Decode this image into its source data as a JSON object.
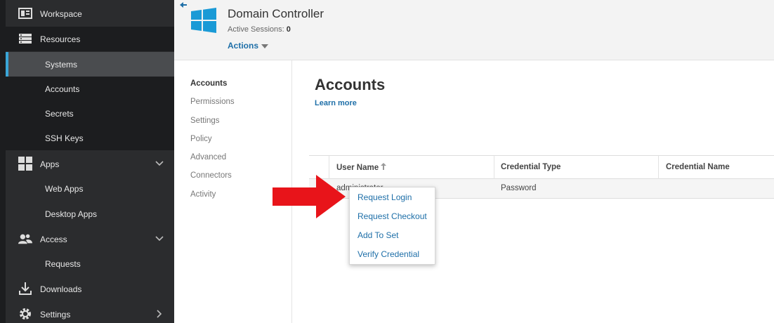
{
  "sidebar": {
    "items": [
      {
        "label": "Workspace"
      },
      {
        "label": "Resources"
      },
      {
        "label": "Systems"
      },
      {
        "label": "Accounts"
      },
      {
        "label": "Secrets"
      },
      {
        "label": "SSH Keys"
      },
      {
        "label": "Apps"
      },
      {
        "label": "Web Apps"
      },
      {
        "label": "Desktop Apps"
      },
      {
        "label": "Access"
      },
      {
        "label": "Requests"
      },
      {
        "label": "Downloads"
      },
      {
        "label": "Settings"
      }
    ]
  },
  "header": {
    "title": "Domain Controller",
    "sessions_label": "Active Sessions:",
    "sessions_count": "0",
    "actions_label": "Actions"
  },
  "subnav": {
    "items": [
      "Accounts",
      "Permissions",
      "Settings",
      "Policy",
      "Advanced",
      "Connectors",
      "Activity"
    ]
  },
  "main": {
    "title": "Accounts",
    "learn_more": "Learn more",
    "table": {
      "headers": [
        "User Name",
        "Credential Type",
        "Credential Name"
      ],
      "rows": [
        {
          "user": "administrator",
          "type": "Password",
          "name": ""
        }
      ]
    }
  },
  "context_menu": {
    "items": [
      "Request Login",
      "Request Checkout",
      "Add To Set",
      "Verify Credential"
    ]
  },
  "colors": {
    "accent": "#3aa6d8",
    "link": "#1e6fa8",
    "sidebar_bg": "#2b2c2e",
    "pointer_arrow": "#e8141a"
  }
}
